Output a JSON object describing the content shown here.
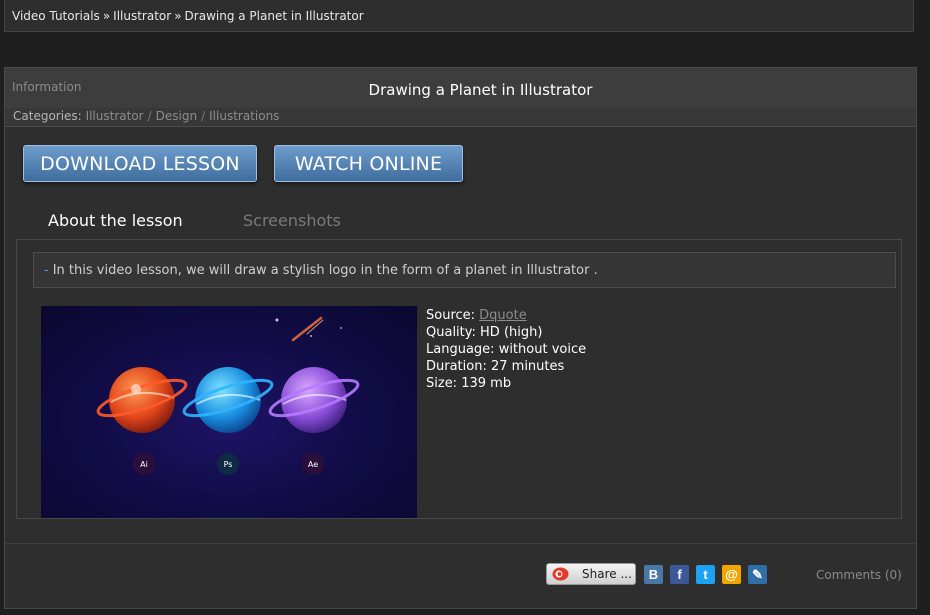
{
  "breadcrumb": {
    "items": [
      "Video Tutorials",
      "Illustrator",
      "Drawing a Planet in Illustrator"
    ],
    "separator": "»"
  },
  "panel": {
    "label": "Information",
    "title": "Drawing a Planet in Illustrator",
    "categories_label": "Categories:",
    "categories": [
      "Illustrator",
      "Design",
      "Illustrations"
    ],
    "categories_separator": "/"
  },
  "actions": {
    "download_label": "DOWNLOAD LESSON",
    "watch_label": "WATCH ONLINE"
  },
  "tabs": [
    {
      "label": "About the lesson",
      "active": true
    },
    {
      "label": "Screenshots",
      "active": false
    }
  ],
  "description": {
    "dash": "-",
    "text": "In this video lesson, we will draw a stylish logo in the form of a planet in Illustrator ."
  },
  "thumbnail": {
    "badges": [
      "Ai",
      "Ps",
      "Ae"
    ]
  },
  "details": {
    "source_label": "Source:",
    "source_value": "Dquote",
    "quality_label": "Quality:",
    "quality_value": "HD (high)",
    "language_label": "Language:",
    "language_value": "without voice",
    "duration_label": "Duration:",
    "duration_value": "27 minutes",
    "size_label": "Size:",
    "size_value": "139 mb"
  },
  "footer": {
    "share_label": "Share ...",
    "social": [
      {
        "name": "vk-icon",
        "glyph": "B",
        "color": "#4a76a8"
      },
      {
        "name": "facebook-icon",
        "glyph": "f",
        "color": "#3b5998"
      },
      {
        "name": "twitter-icon",
        "glyph": "t",
        "color": "#1da1f2"
      },
      {
        "name": "mail-icon",
        "glyph": "@",
        "color": "#f2a400"
      },
      {
        "name": "livejournal-icon",
        "glyph": "✎",
        "color": "#2e6fa7"
      }
    ],
    "comments_label": "Comments (0)"
  },
  "colors": {
    "accent": "#4f7fb0",
    "background": "#1f1f1f",
    "panel": "#2e2e2e"
  }
}
